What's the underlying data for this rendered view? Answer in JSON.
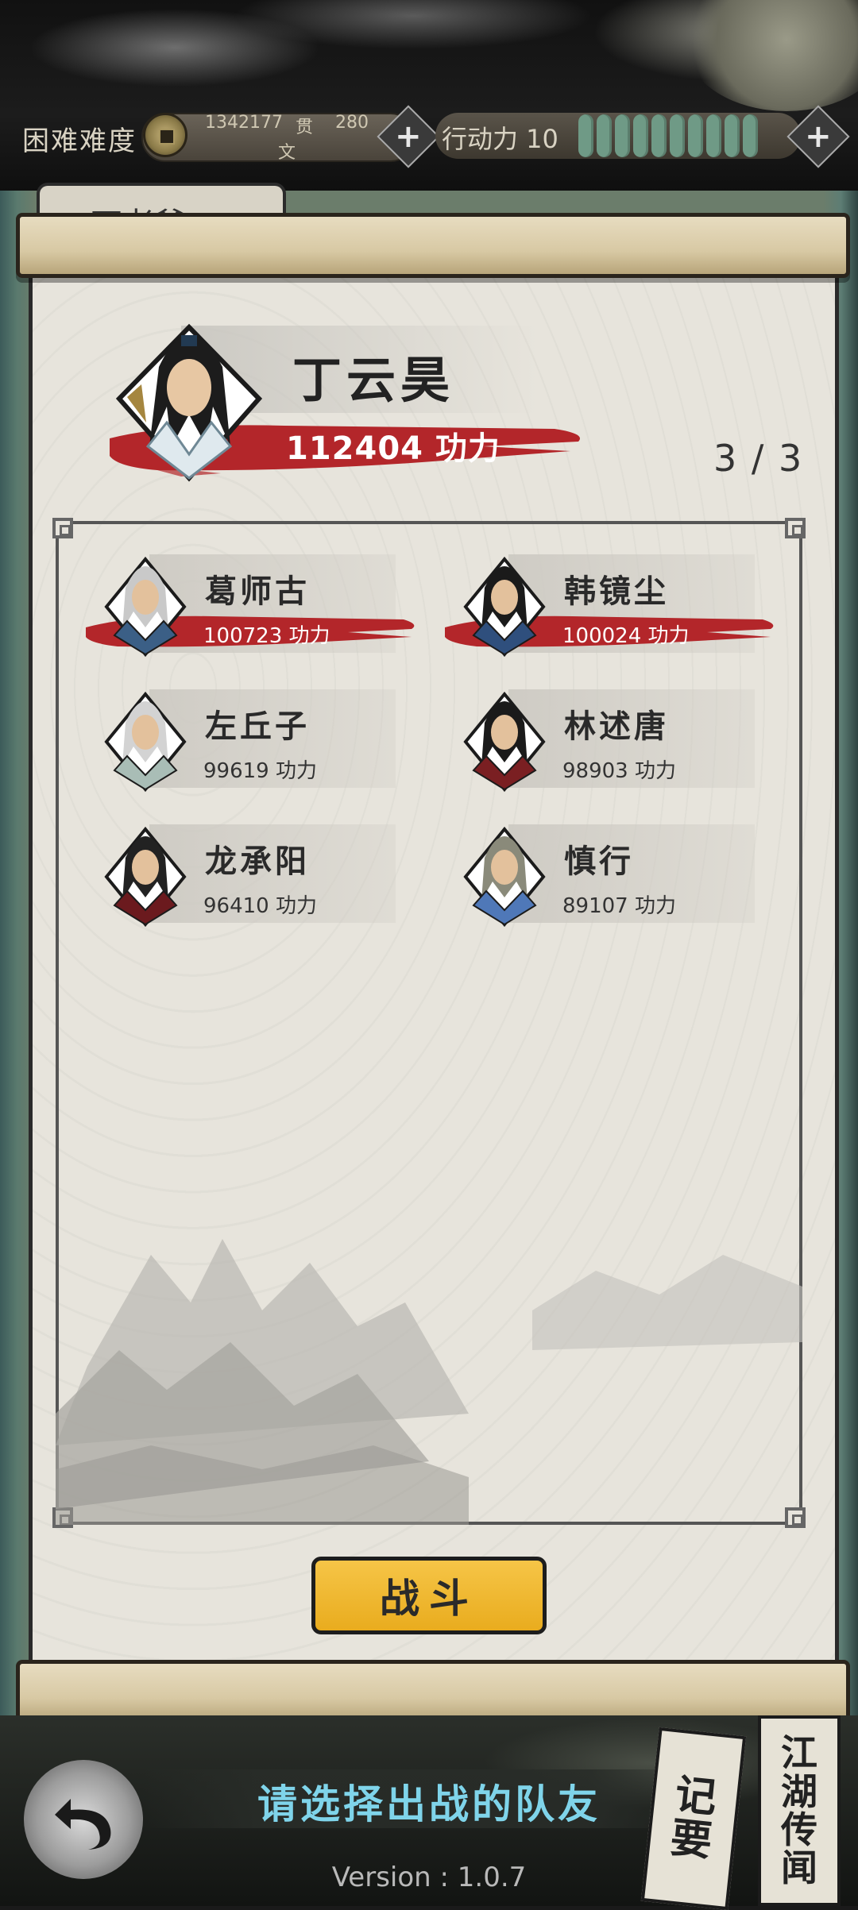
{
  "header": {
    "difficulty": "困难难度",
    "coin_amount": "1342177",
    "coin_unit": "文",
    "guan_label": "贯",
    "guan_value": "280",
    "action_label": "行动力 10",
    "action_points": 10,
    "action_points_max": 10
  },
  "background_tab": {
    "label": "丁老爷"
  },
  "leader": {
    "name": "丁云昊",
    "power": "112404 功力"
  },
  "selection_count": "3 / 3",
  "companions": [
    {
      "name": "葛师古",
      "power": "100723 功力",
      "selected": true
    },
    {
      "name": "韩镜尘",
      "power": "100024 功力",
      "selected": true
    },
    {
      "name": "左丘子",
      "power": "99619 功力",
      "selected": false
    },
    {
      "name": "林述唐",
      "power": "98903 功力",
      "selected": false
    },
    {
      "name": "龙承阳",
      "power": "96410 功力",
      "selected": false
    },
    {
      "name": "慎行",
      "power": "89107 功力",
      "selected": false
    }
  ],
  "battle_button": "战斗",
  "hint": "请选择出战的队友",
  "side_buttons": {
    "notes": [
      "记",
      "要"
    ],
    "rumors": [
      "江",
      "湖",
      "传",
      "闻"
    ]
  },
  "version": "Version : 1.0.7",
  "colors": {
    "accent_gold": "#f0b934",
    "brush_red": "#b3262a",
    "hint_cyan": "#7fd4ea",
    "action_green": "#6f9a86"
  }
}
